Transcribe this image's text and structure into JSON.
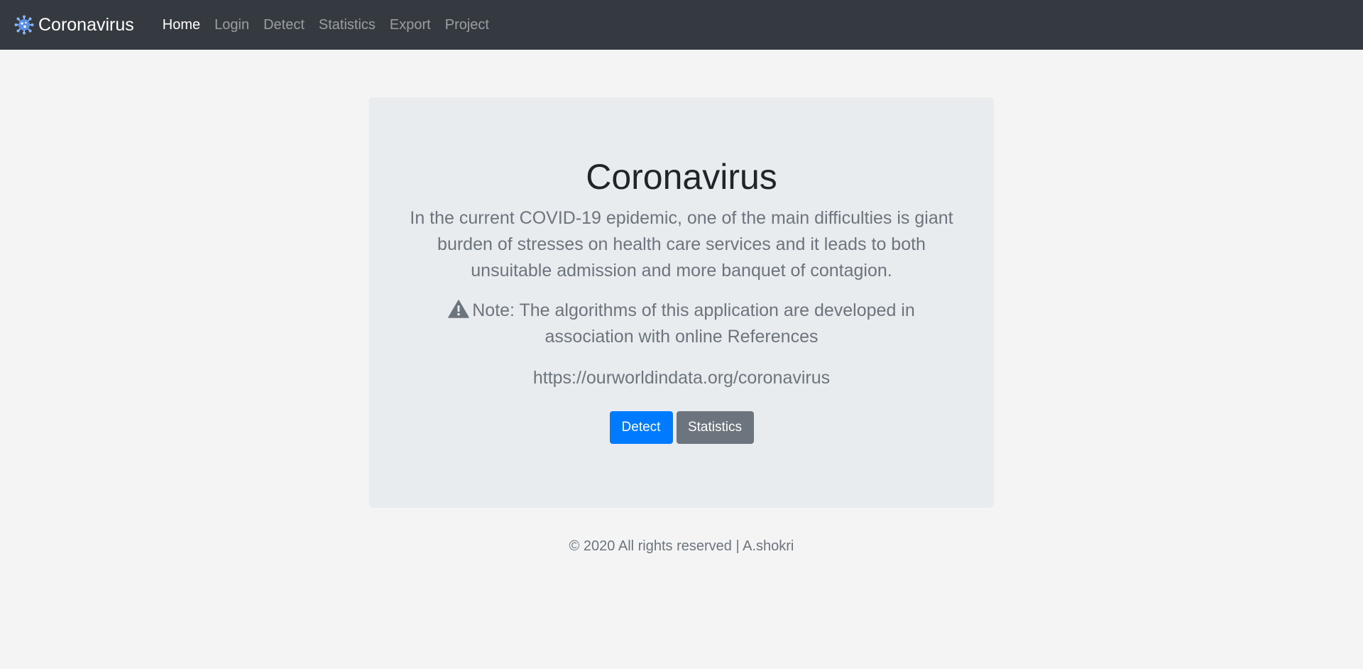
{
  "navbar": {
    "brand": "Coronavirus",
    "brand_icon": "virus-icon",
    "links": [
      {
        "label": "Home",
        "active": true
      },
      {
        "label": "Login",
        "active": false
      },
      {
        "label": "Detect",
        "active": false
      },
      {
        "label": "Statistics",
        "active": false
      },
      {
        "label": "Export",
        "active": false
      },
      {
        "label": "Project",
        "active": false
      }
    ]
  },
  "jumbotron": {
    "title": "Coronavirus",
    "lead": "In the current COVID-19 epidemic, one of the main difficulties is giant burden of stresses on health care services and it leads to both unsuitable admission and more banquet of contagion.",
    "note_icon": "warning-icon",
    "note": "Note: The algorithms of this application are developed in association with online References",
    "url": "https://ourworldindata.org/coronavirus",
    "buttons": {
      "detect": "Detect",
      "statistics": "Statistics"
    }
  },
  "footer": {
    "text": "© 2020 All rights reserved | A.shokri"
  },
  "colors": {
    "navbar_bg": "#343a40",
    "page_bg": "#f4f4f4",
    "card_bg": "#e9ecef",
    "primary": "#007bff",
    "secondary": "#6c757d"
  }
}
